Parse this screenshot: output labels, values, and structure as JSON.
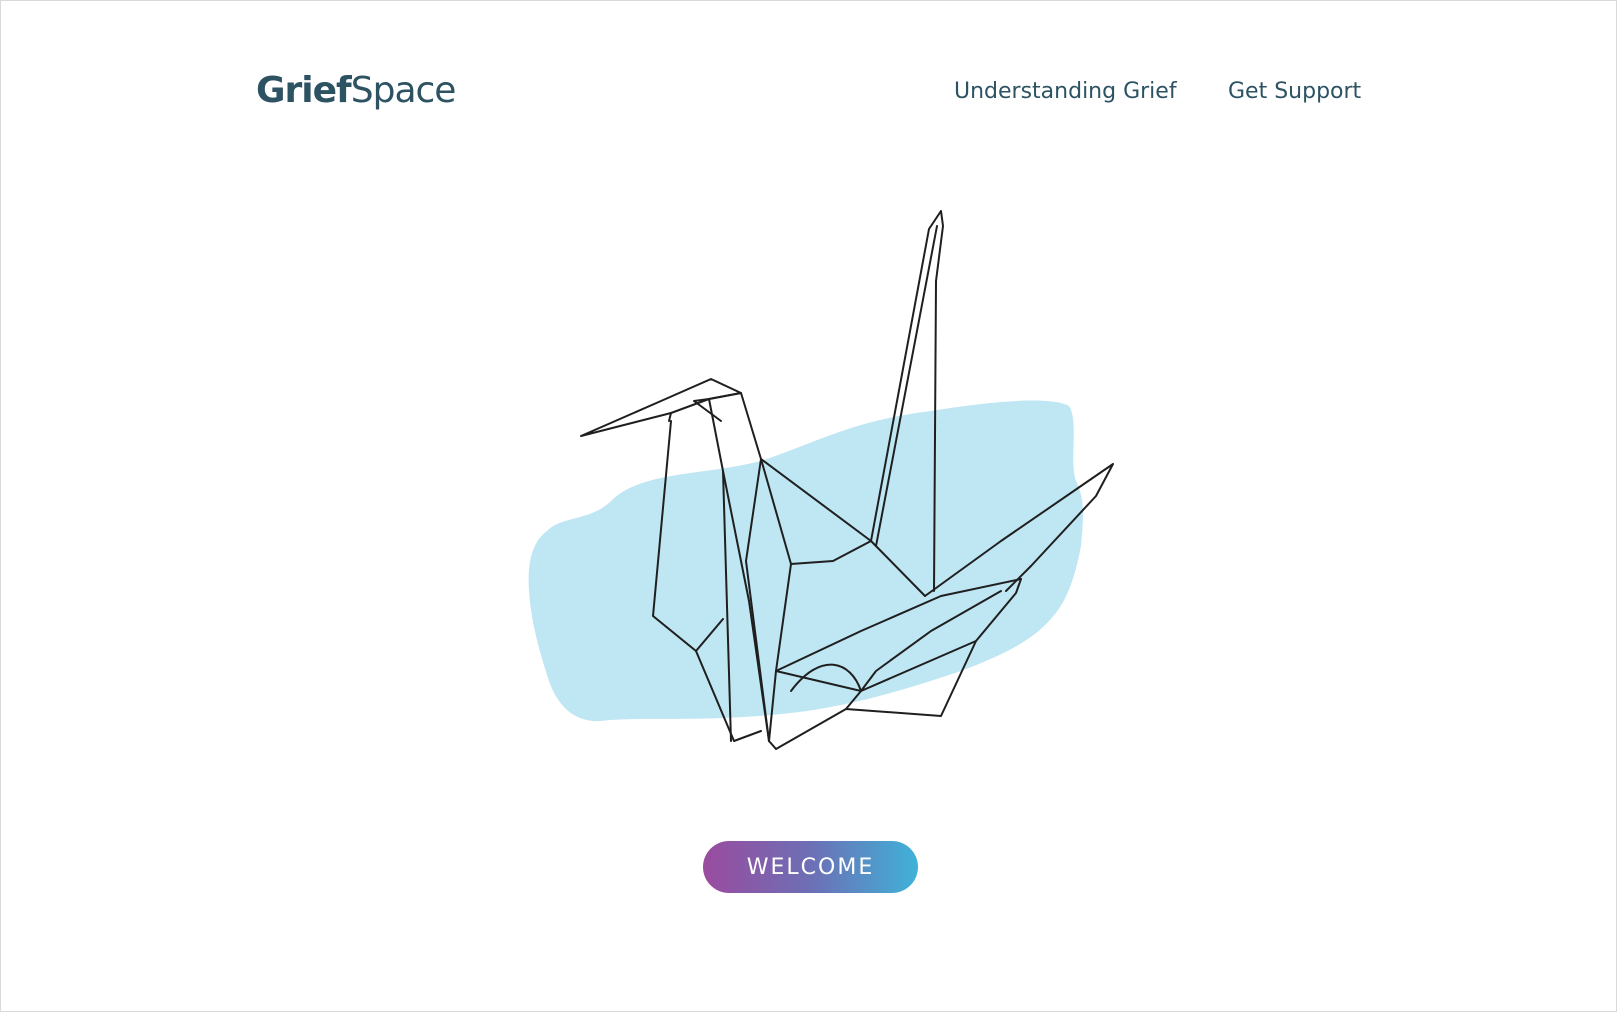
{
  "brand": {
    "name_primary": "Grief",
    "name_secondary": "Space"
  },
  "nav": {
    "items": [
      {
        "label": "Understanding  Grief"
      },
      {
        "label": "Get Support"
      }
    ]
  },
  "hero": {
    "illustration": "origami-crane-icon",
    "accent_color": "#bfe6f3",
    "line_color": "#1f1f1f"
  },
  "cta": {
    "label": "WELCOME",
    "gradient_start": "#9a4b9f",
    "gradient_end": "#3fb2d8"
  },
  "colors": {
    "text": "#2d5363",
    "background": "#ffffff"
  }
}
